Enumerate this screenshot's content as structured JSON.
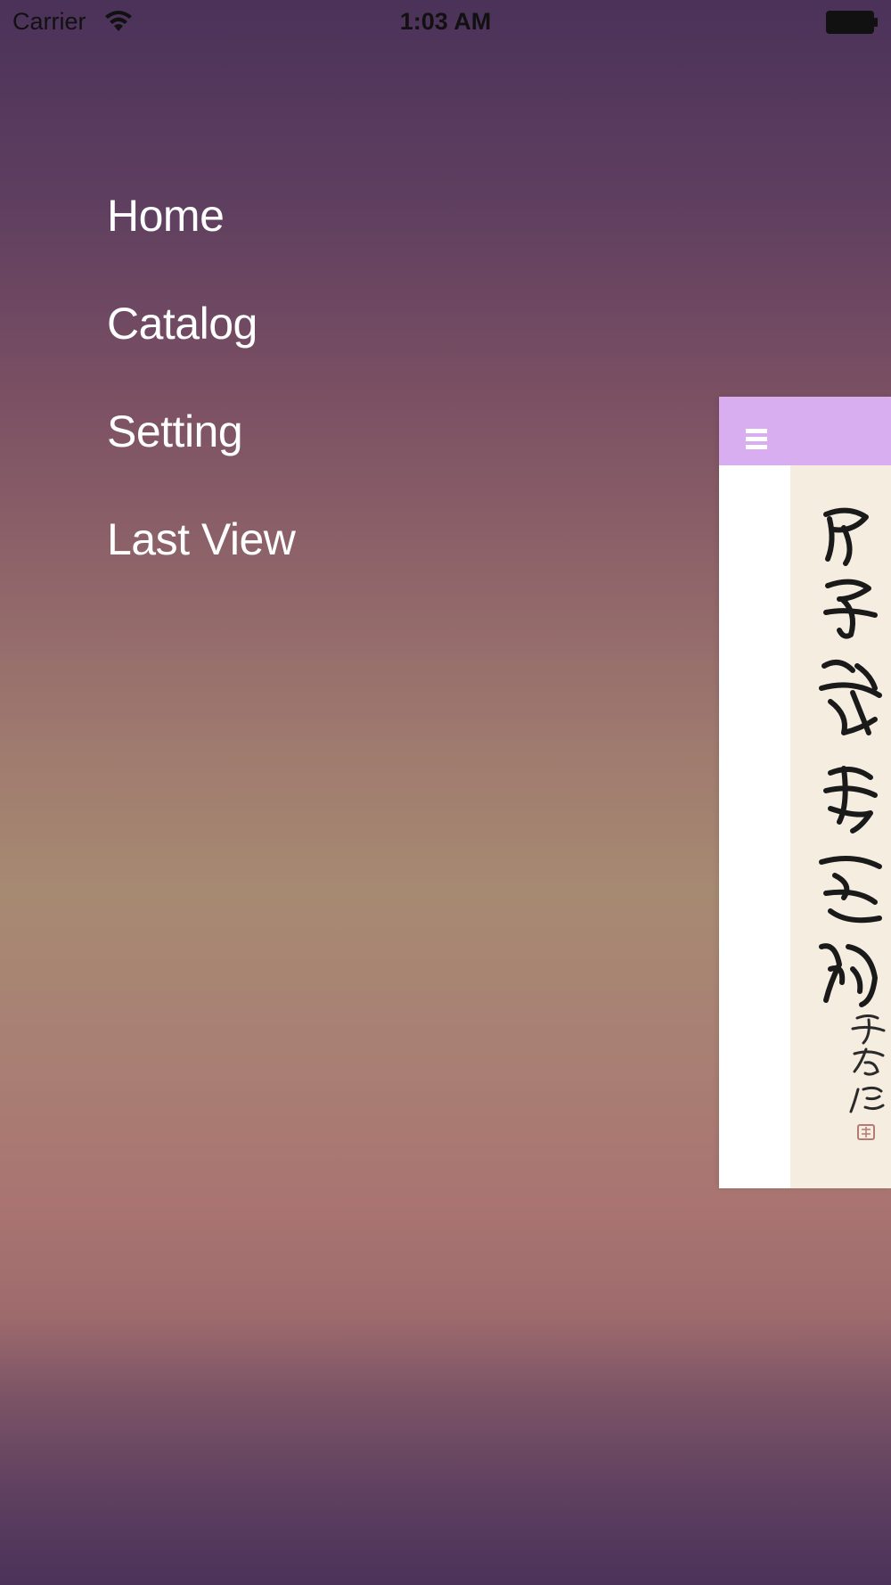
{
  "status_bar": {
    "carrier": "Carrier",
    "time": "1:03 AM",
    "wifi_icon": "wifi-icon",
    "battery_icon": "battery-icon"
  },
  "menu": {
    "items": [
      {
        "label": "Home"
      },
      {
        "label": "Catalog"
      },
      {
        "label": "Setting"
      },
      {
        "label": "Last View"
      }
    ]
  },
  "content_panel": {
    "menu_icon": "hamburger-icon",
    "image": "calligraphy-scroll"
  },
  "colors": {
    "navbar": "#d8aef0",
    "menu_text": "#ffffff",
    "background_top": "#4b3259",
    "background_mid": "#a78a72"
  }
}
